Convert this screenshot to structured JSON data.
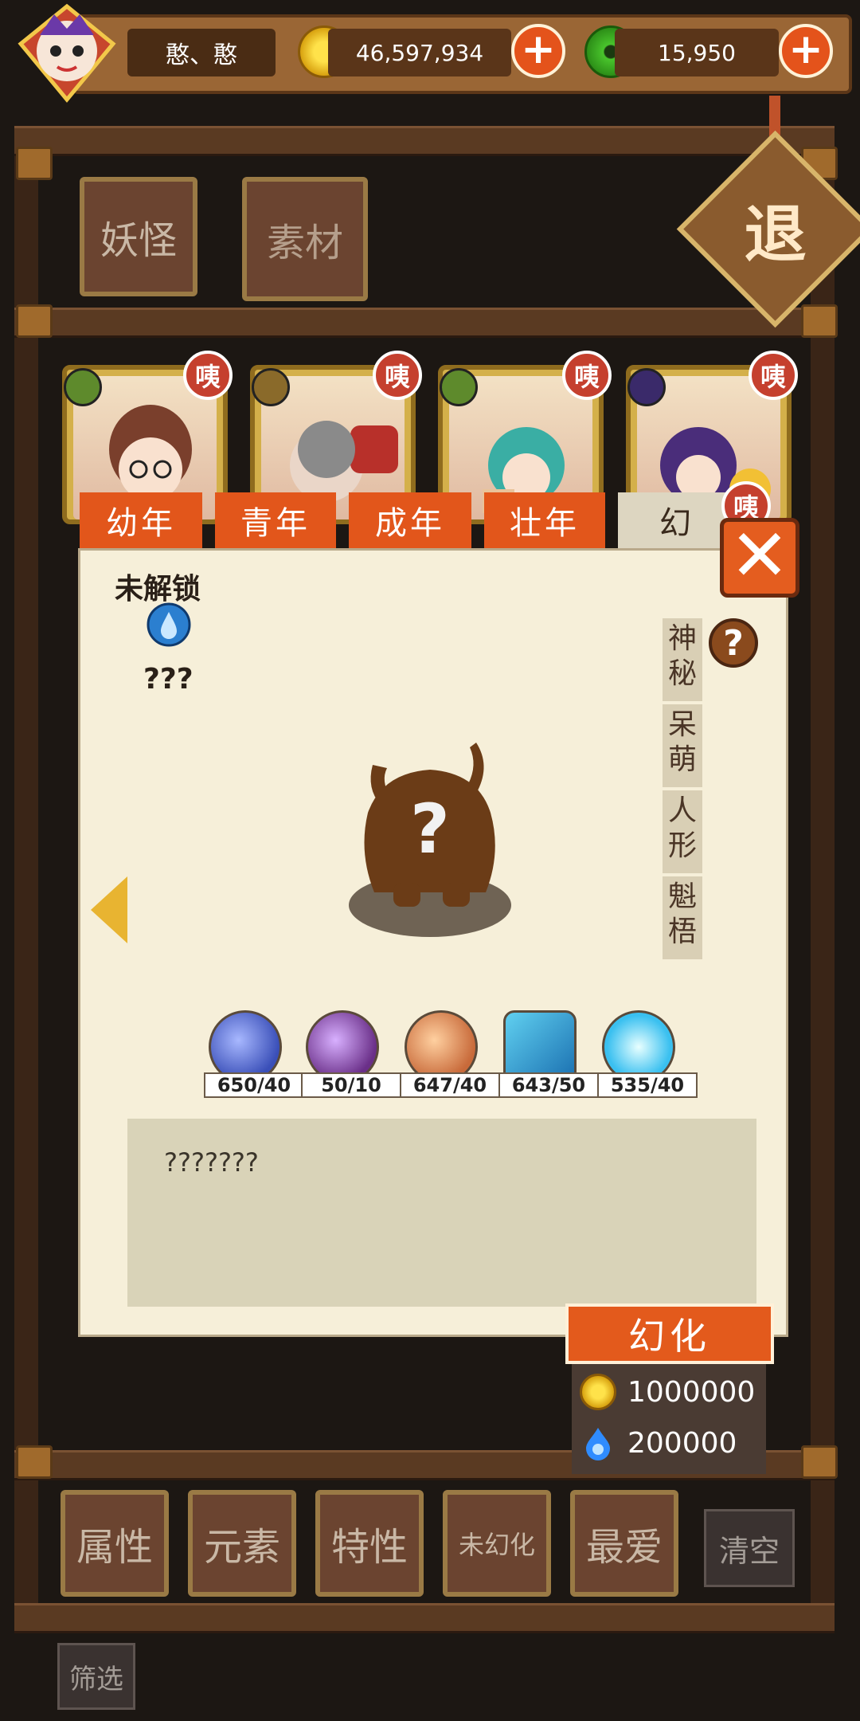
{
  "header": {
    "player_name": "憨、憨",
    "gold_amount": "46,597,934",
    "jade_amount": "15,950"
  },
  "categories": {
    "monster": "妖怪",
    "material": "素材"
  },
  "exit_label": "退",
  "card_badge": "咦",
  "tabs": [
    "幼年",
    "青年",
    "成年",
    "壮年",
    "幻"
  ],
  "panel": {
    "status": "未解锁",
    "name": "???",
    "tags": [
      "神秘",
      "呆萌",
      "人形",
      "魁梧"
    ],
    "help_symbol": "?",
    "description": "???????",
    "skills": [
      {
        "have": "650",
        "need": "40",
        "color": "#4a6fd8"
      },
      {
        "have": "50",
        "need": "10",
        "color": "#8a4fa8"
      },
      {
        "have": "647",
        "need": "40",
        "color": "#e08a4a"
      },
      {
        "have": "643",
        "need": "50",
        "color": "#1f8bd0"
      },
      {
        "have": "535",
        "need": "40",
        "color": "#40c4f0"
      }
    ]
  },
  "transform": {
    "label": "幻化",
    "gold_cost": "1000000",
    "soul_cost": "200000"
  },
  "filters": [
    "属性",
    "元素",
    "特性",
    "未幻化",
    "最爱"
  ],
  "clear_label": "清空",
  "filter_label": "筛选"
}
